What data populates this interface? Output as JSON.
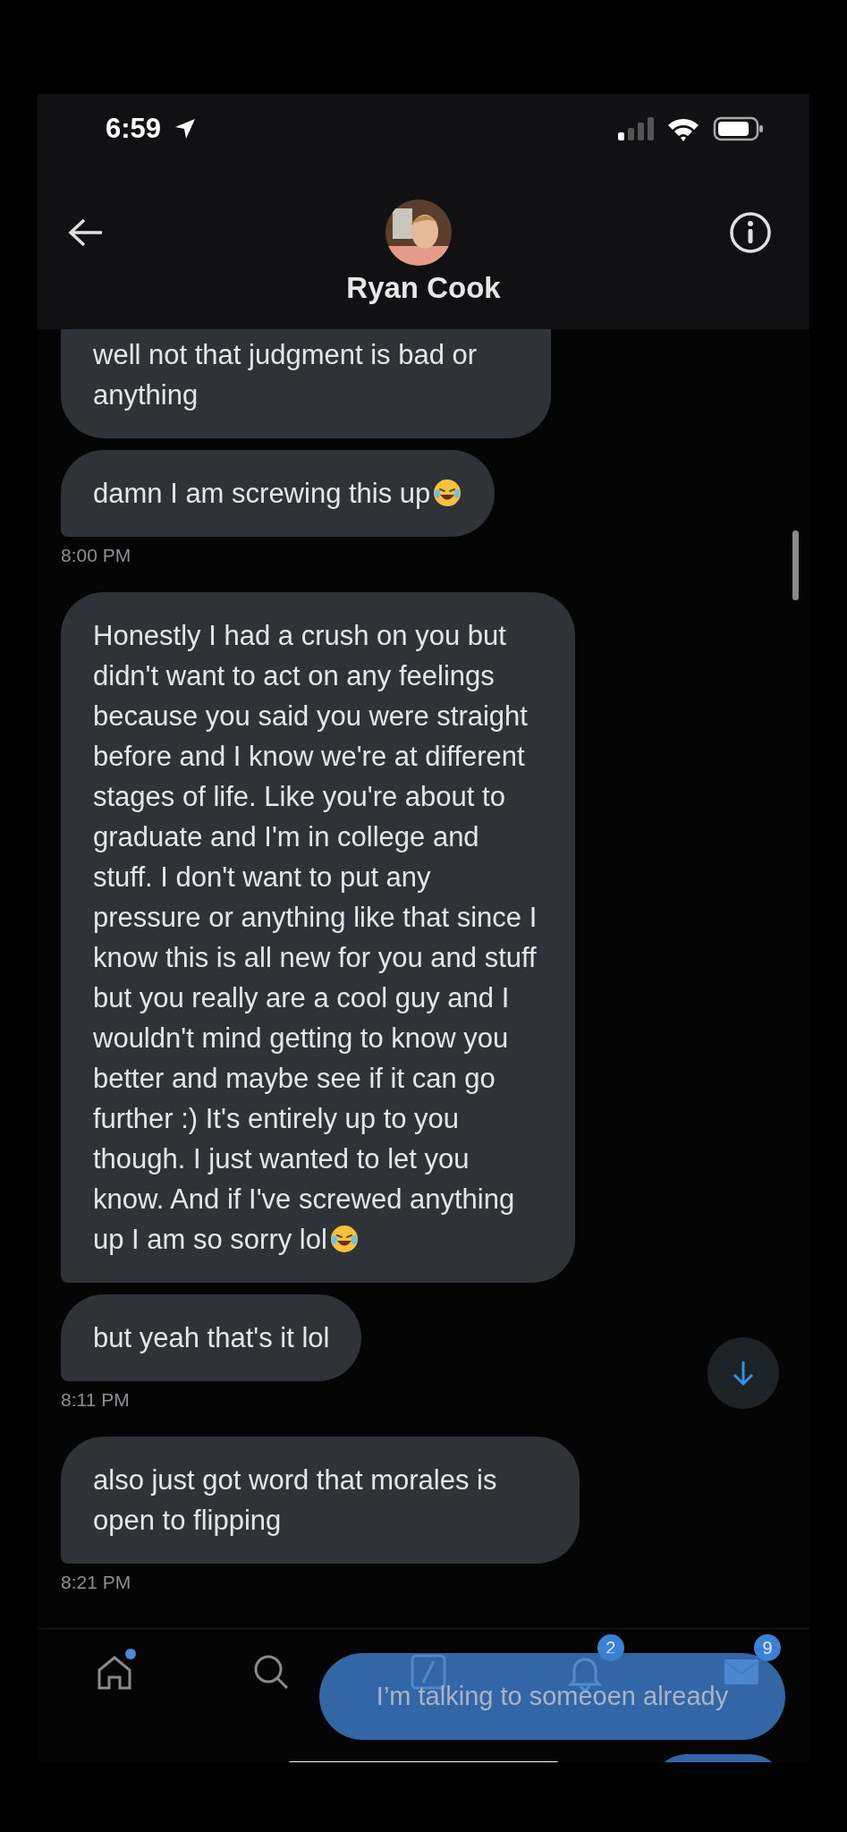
{
  "status_bar": {
    "time": "6:59"
  },
  "header": {
    "name": "Ryan Cook"
  },
  "messages": [
    {
      "kind": "bubble",
      "text": "well not that judgment is bad or anything",
      "cut_top": true,
      "emoji": false
    },
    {
      "kind": "bubble",
      "text": "damn I am screwing this up",
      "cut_top": false,
      "emoji": true
    },
    {
      "kind": "time",
      "text": "8:00 PM"
    },
    {
      "kind": "bubble",
      "text": "Honestly I had a crush on you but didn't want to act on any feelings because you said you were straight before and I know we're at different stages of life. Like you're about to graduate and I'm in college and stuff. I don't want to put any pressure or anything like that since I know this is all new for you and stuff but you really are a cool guy and I wouldn't mind getting to know you better and maybe see if it can go further :) It's entirely up to you though. I just wanted to let you know. And if I've screwed anything up I am so sorry lol",
      "cut_top": false,
      "emoji": true
    },
    {
      "kind": "bubble",
      "text": "but yeah that's it lol",
      "cut_top": false,
      "emoji": false
    },
    {
      "kind": "time",
      "text": "8:11 PM"
    },
    {
      "kind": "bubble",
      "text": "also just got word that morales is open to flipping",
      "cut_top": false,
      "emoji": false
    },
    {
      "kind": "time",
      "text": "8:21 PM"
    }
  ],
  "nav": [
    {
      "kind": "home",
      "dot": true
    },
    {
      "kind": "search",
      "dot": false
    },
    {
      "kind": "compose",
      "dot": false
    },
    {
      "kind": "notifications",
      "dot": false,
      "badge": "2"
    },
    {
      "kind": "messages",
      "dot": false,
      "badge": "9"
    }
  ],
  "overlay_bubble": {
    "text": "I’m talking to someoen already"
  }
}
